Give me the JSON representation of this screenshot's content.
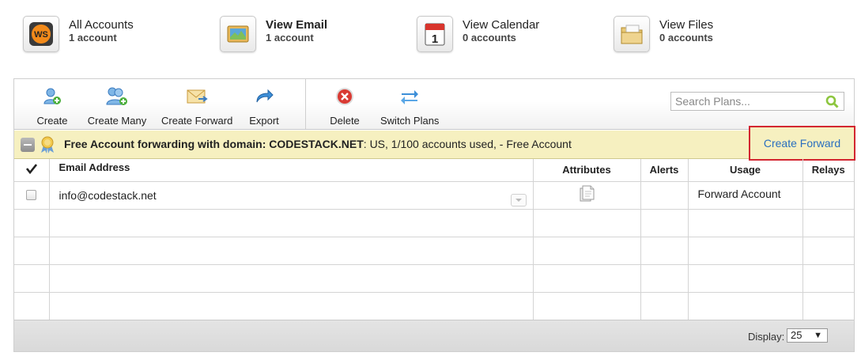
{
  "quicknav": [
    {
      "title": "All Accounts",
      "count": "1 account",
      "icon": "ws-logo-icon"
    },
    {
      "title": "View Email",
      "count": "1 account",
      "icon": "email-map-icon"
    },
    {
      "title": "View Calendar",
      "count": "0 accounts",
      "icon": "calendar-icon"
    },
    {
      "title": "View Files",
      "count": "0 accounts",
      "icon": "files-folder-icon"
    }
  ],
  "toolbar": {
    "create": "Create",
    "create_many": "Create Many",
    "create_forward": "Create Forward",
    "export": "Export",
    "delete": "Delete",
    "switch_plans": "Switch Plans"
  },
  "search": {
    "placeholder": "Search Plans..."
  },
  "plan": {
    "bold_text": "Free Account forwarding with domain: CODESTACK.NET",
    "detail_text": ": US, 1/100 accounts used, - Free Account",
    "action_link": "Create Forward"
  },
  "table": {
    "columns": [
      "",
      "Email Address",
      "Attributes",
      "Alerts",
      "Usage",
      "Relays"
    ],
    "rows": [
      {
        "email": "info@codestack.net",
        "attributes": "document-icon",
        "alerts": "",
        "usage": "Forward Account",
        "relays": ""
      }
    ]
  },
  "footer": {
    "display_label": "Display:",
    "display_value": "25"
  },
  "colors": {
    "plan_bar": "#f6f0c0",
    "highlight_border": "#d32630",
    "link": "#2a6fbf"
  }
}
